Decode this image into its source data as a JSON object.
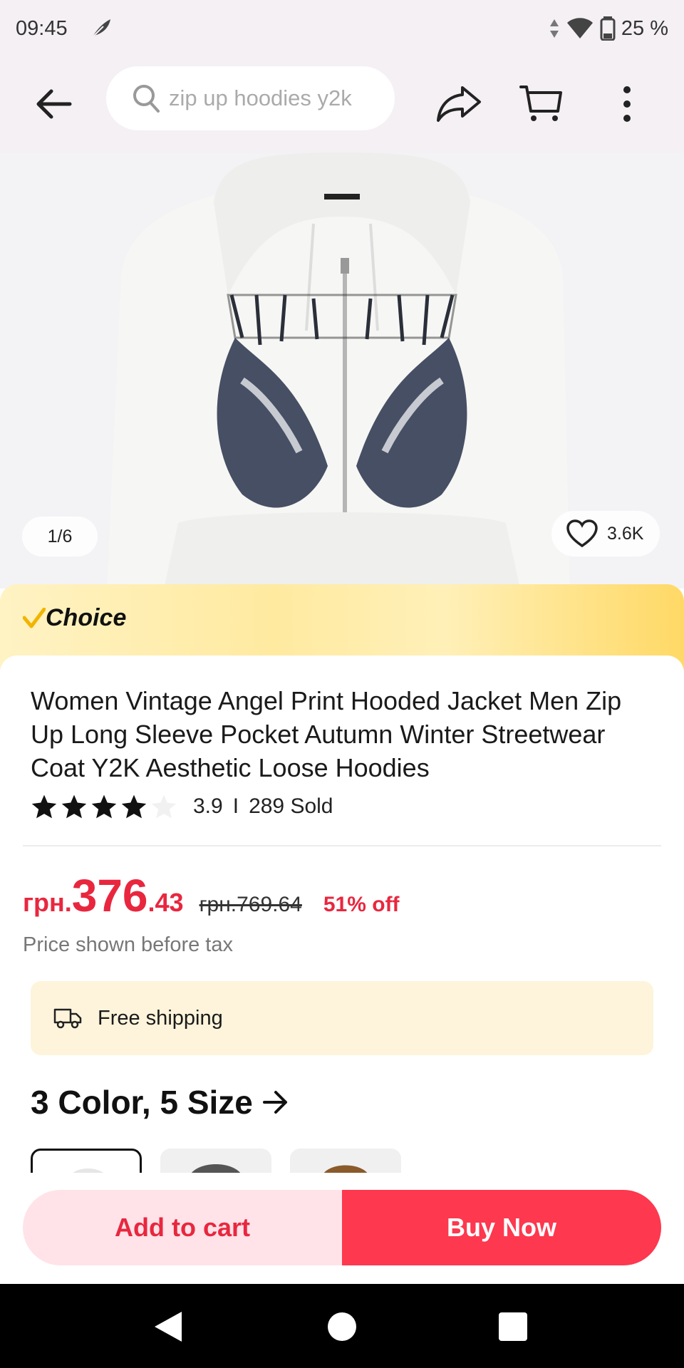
{
  "status_bar": {
    "time": "09:45",
    "battery": "25 %"
  },
  "search": {
    "placeholder": "zip up hoodies y2k"
  },
  "gallery": {
    "counter": "1/6",
    "wishlist_count": "3.6K"
  },
  "banner": {
    "label": "Choice"
  },
  "product": {
    "title": "Women Vintage Angel Print Hooded Jacket Men Zip Up Long Sleeve Pocket Autumn Winter Streetwear Coat Y2K Aesthetic Loose Hoodies",
    "rating": "3.9",
    "rating_stars": 3.9,
    "separator": "I",
    "sold": "289 Sold"
  },
  "price": {
    "currency": "грн.",
    "integer": "376",
    "decimal": ".43",
    "original": "грн.769.64",
    "discount": "51% off",
    "tax_note": "Price shown before tax"
  },
  "shipping": {
    "label": "Free shipping"
  },
  "variants": {
    "summary": "3 Color, 5 Size"
  },
  "actions": {
    "add_to_cart": "Add to cart",
    "buy_now": "Buy Now"
  },
  "colors": {
    "accent": "#fd384f",
    "price_red": "#e8273f",
    "shipping_bg": "#fdf4db",
    "choice_gold": "#ffd966"
  }
}
